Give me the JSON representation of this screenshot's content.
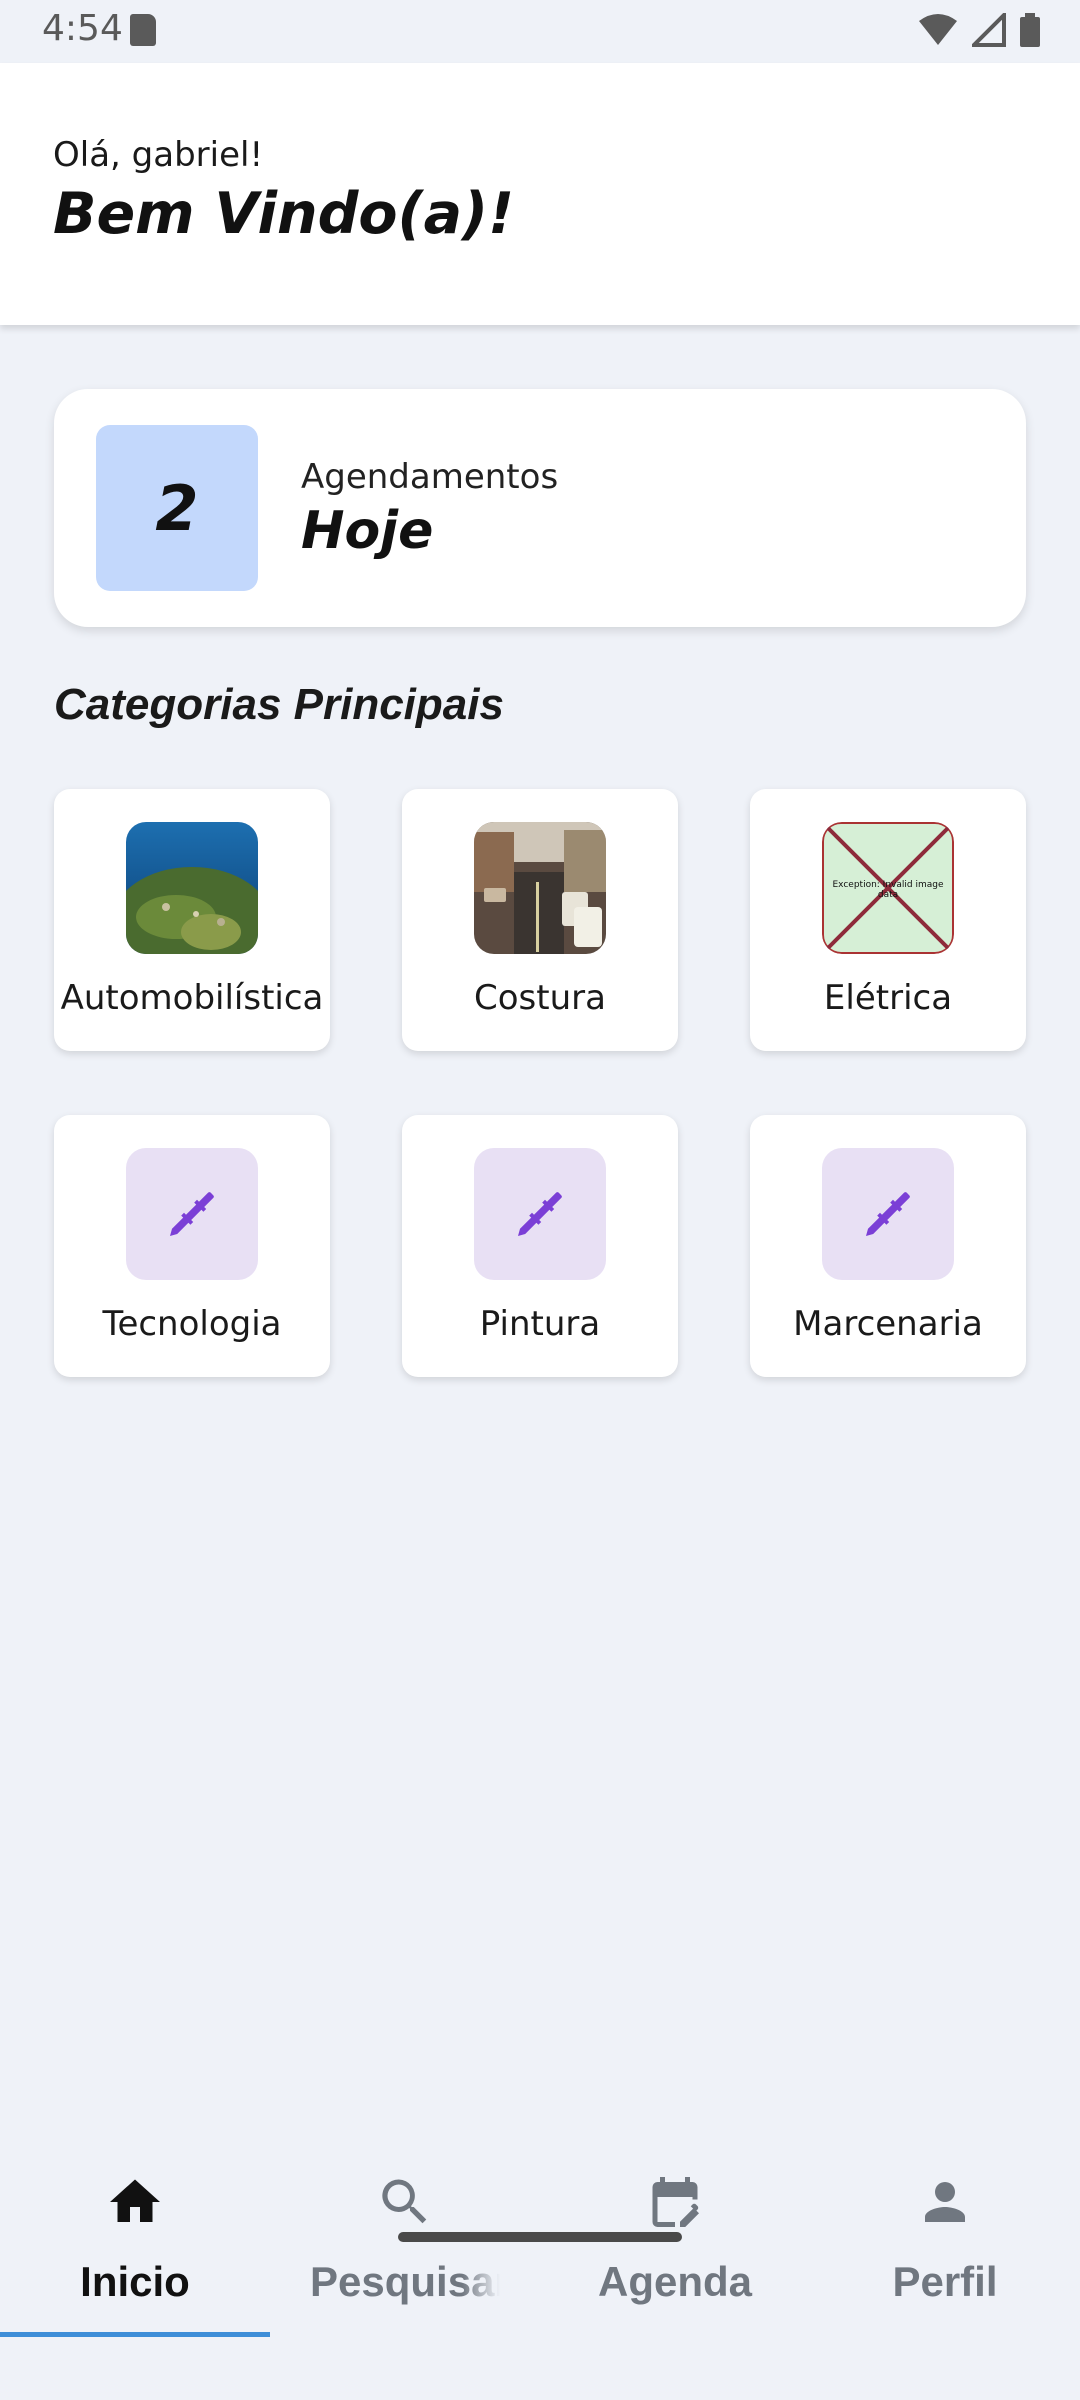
{
  "status": {
    "time": "4:54"
  },
  "header": {
    "greeting": "Olá, gabriel!",
    "welcome": "Bem Vindo(a)!"
  },
  "appointments": {
    "count": "2",
    "label": "Agendamentos",
    "sub": "Hoje",
    "count_bg": "#c3d8fc"
  },
  "categories": {
    "title": "Categorias Principais",
    "items": [
      {
        "label": "Automobilística",
        "icon": "island-photo"
      },
      {
        "label": "Costura",
        "icon": "street-photo"
      },
      {
        "label": "Elétrica",
        "icon": "invalid-image-placeholder",
        "error_text": "Exception: Invalid image data"
      },
      {
        "label": "Tecnologia",
        "icon": "wrench-icon"
      },
      {
        "label": "Pintura",
        "icon": "wrench-icon"
      },
      {
        "label": "Marcenaria",
        "icon": "wrench-icon"
      }
    ],
    "icon_color": "#7b3fd6",
    "icon_bg": "#e8e0f4"
  },
  "nav": {
    "items": [
      {
        "label": "Inicio",
        "icon": "home-icon",
        "active": true
      },
      {
        "label": "Pesquisar",
        "icon": "search-icon",
        "active": false
      },
      {
        "label": "Agenda",
        "icon": "calendar-edit-icon",
        "active": false
      },
      {
        "label": "Perfil",
        "icon": "person-icon",
        "active": false
      }
    ],
    "accent": "#3e8ed8"
  }
}
